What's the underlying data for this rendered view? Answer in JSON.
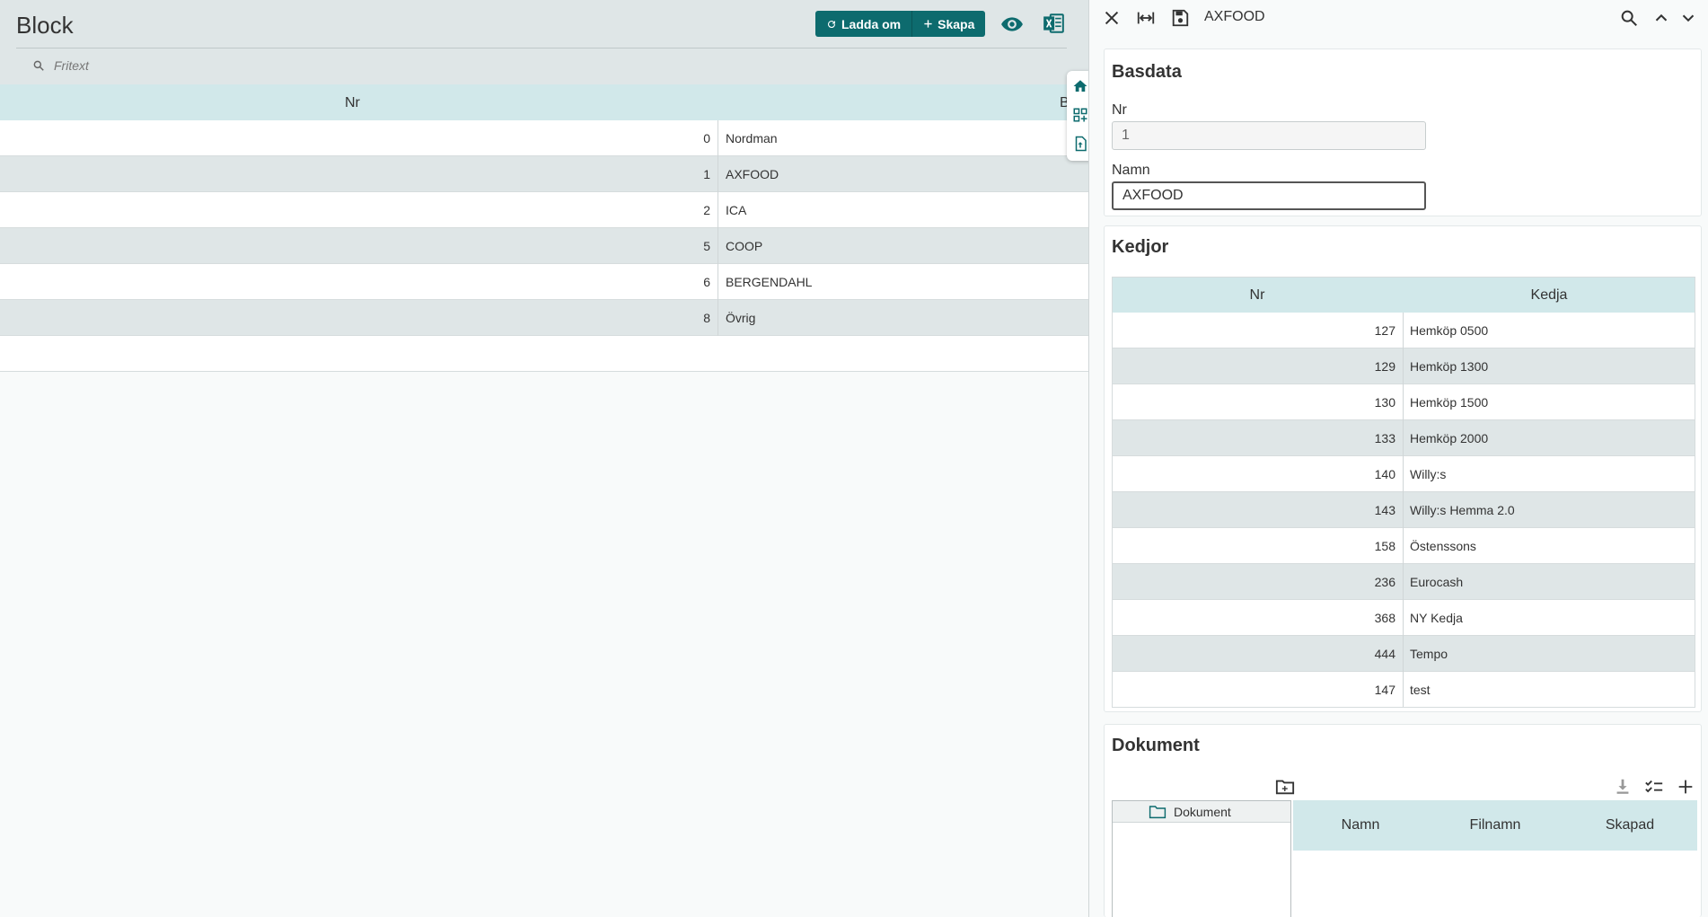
{
  "left": {
    "title": "Block",
    "buttons": {
      "reload_label": "Ladda om",
      "create_label": "Skapa"
    },
    "search": {
      "placeholder": "Fritext"
    },
    "table": {
      "headers": {
        "nr": "Nr",
        "b": "B"
      },
      "rows": [
        {
          "nr": "0",
          "name": "Nordman"
        },
        {
          "nr": "1",
          "name": "AXFOOD"
        },
        {
          "nr": "2",
          "name": "ICA"
        },
        {
          "nr": "5",
          "name": "COOP"
        },
        {
          "nr": "6",
          "name": "BERGENDAHL"
        },
        {
          "nr": "8",
          "name": "Övrig"
        }
      ]
    }
  },
  "right": {
    "title": "AXFOOD",
    "basdata": {
      "title": "Basdata",
      "nr_label": "Nr",
      "nr_value": "1",
      "namn_label": "Namn",
      "namn_value": "AXFOOD"
    },
    "kedjor": {
      "title": "Kedjor",
      "headers": {
        "nr": "Nr",
        "kedja": "Kedja"
      },
      "rows": [
        {
          "nr": "127",
          "name": "Hemköp 0500"
        },
        {
          "nr": "129",
          "name": "Hemköp 1300"
        },
        {
          "nr": "130",
          "name": "Hemköp 1500"
        },
        {
          "nr": "133",
          "name": "Hemköp 2000"
        },
        {
          "nr": "140",
          "name": "Willy:s"
        },
        {
          "nr": "143",
          "name": "Willy:s Hemma 2.0"
        },
        {
          "nr": "158",
          "name": "Östenssons"
        },
        {
          "nr": "236",
          "name": "Eurocash"
        },
        {
          "nr": "368",
          "name": "NY Kedja"
        },
        {
          "nr": "444",
          "name": "Tempo"
        },
        {
          "nr": "147",
          "name": "test"
        }
      ]
    },
    "dokument": {
      "title": "Dokument",
      "tree_root": "Dokument",
      "headers": {
        "namn": "Namn",
        "filnamn": "Filnamn",
        "skapad": "Skapad"
      }
    }
  },
  "colors": {
    "accent": "#0d6b6e",
    "header_bg": "#dfe6e7",
    "table_header_bg": "#d1e8ea",
    "row_alt_bg": "#dfe6e7"
  }
}
